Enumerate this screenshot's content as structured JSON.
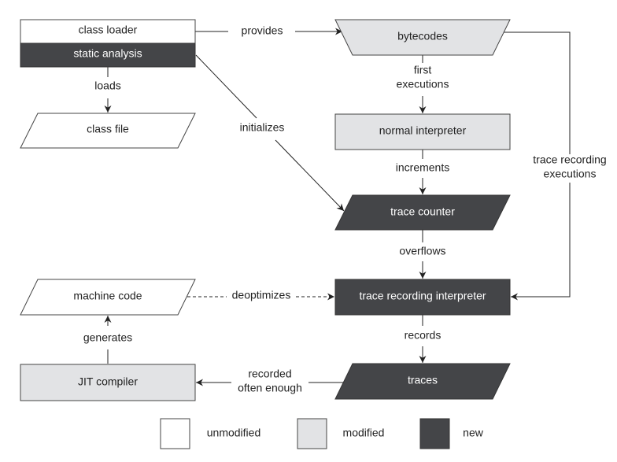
{
  "nodes": {
    "class_loader": "class loader",
    "static_analysis": "static analysis",
    "class_file": "class file",
    "bytecodes": "bytecodes",
    "normal_interpreter": "normal interpreter",
    "trace_counter": "trace counter",
    "trace_recording_interpreter": "trace recording interpreter",
    "machine_code": "machine code",
    "traces": "traces",
    "jit_compiler": "JIT compiler"
  },
  "edges": {
    "provides": "provides",
    "loads": "loads",
    "initializes": "initializes",
    "first": "first",
    "executions": "executions",
    "increments": "increments",
    "overflows": "overflows",
    "trace_recording": "trace recording",
    "trace_executions": "executions",
    "deoptimizes": "deoptimizes",
    "generates": "generates",
    "records": "records",
    "recorded": "recorded",
    "often_enough": "often enough"
  },
  "legend": {
    "unmodified": "unmodified",
    "modified": "modified",
    "new": "new"
  },
  "colors": {
    "unmodified": "#ffffff",
    "modified": "#e2e3e5",
    "new": "#444548"
  }
}
